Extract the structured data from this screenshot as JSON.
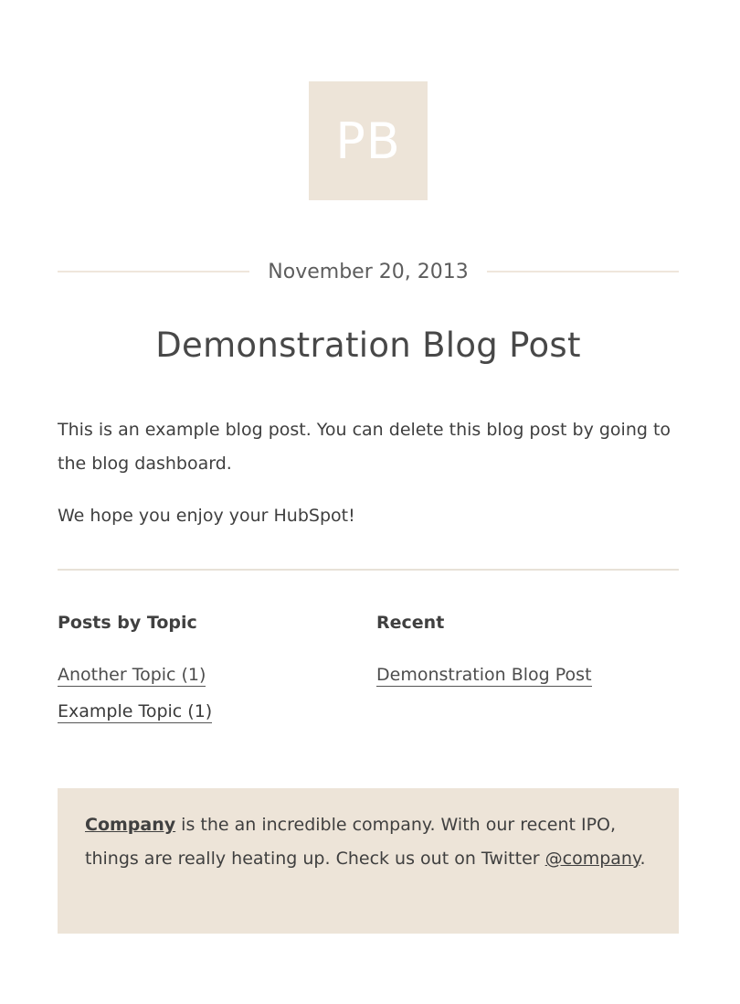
{
  "logo": {
    "text": "PB"
  },
  "post": {
    "date": "November 20, 2013",
    "title": "Demonstration Blog Post",
    "paragraphs": [
      "This is an example blog post. You can delete this blog post by going to the blog dashboard.",
      "We hope you enjoy your HubSpot!"
    ]
  },
  "topics": {
    "heading": "Posts by Topic",
    "items": [
      "Another Topic (1)",
      "Example Topic (1)"
    ]
  },
  "recent": {
    "heading": "Recent",
    "items": [
      "Demonstration Blog Post"
    ]
  },
  "footer": {
    "company_link": "Company",
    "text_middle": " is the an incredible company. With our recent IPO, things are really heating up. Check us out on Twitter ",
    "twitter_link": "@company",
    "text_end": "."
  },
  "colors": {
    "accent_beige": "#ede4d8",
    "text_dark": "#3f3f3f"
  }
}
